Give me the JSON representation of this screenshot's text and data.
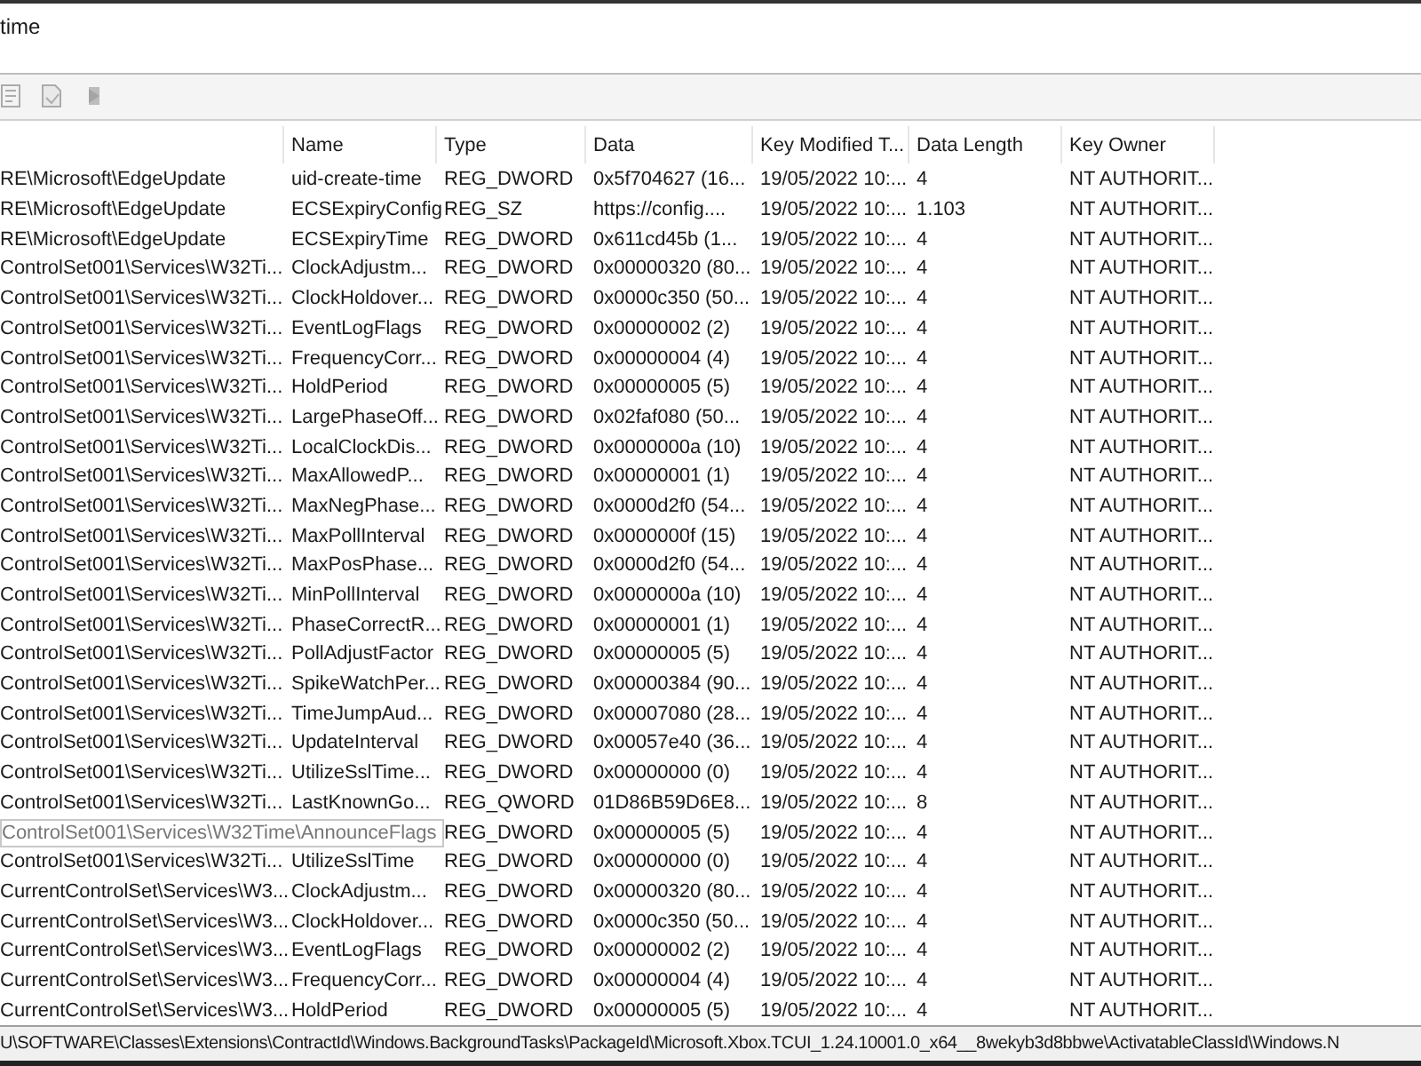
{
  "window": {
    "title": "time"
  },
  "toolbar": {
    "buttons": [
      {
        "kind": "properties",
        "disabled": true
      },
      {
        "kind": "export",
        "disabled": true
      },
      {
        "kind": "jump",
        "disabled": true
      }
    ]
  },
  "table": {
    "columns": [
      "",
      "Name",
      "Type",
      "Data",
      "Key Modified T...",
      "Data Length",
      "Key Owner"
    ],
    "rows": [
      {
        "kind": "entry",
        "cells": [
          "RE\\Microsoft\\EdgeUpdate",
          "uid-create-time",
          "REG_DWORD",
          "0x5f704627 (16...",
          "19/05/2022 10:...",
          "4",
          "NT AUTHORIT..."
        ]
      },
      {
        "kind": "entry",
        "cells": [
          "RE\\Microsoft\\EdgeUpdate",
          "ECSExpiryConfig",
          "REG_SZ",
          "https://config....",
          "19/05/2022 10:...",
          "1.103",
          "NT AUTHORIT..."
        ]
      },
      {
        "kind": "entry",
        "cells": [
          "RE\\Microsoft\\EdgeUpdate",
          "ECSExpiryTime",
          "REG_DWORD",
          "0x611cd45b (1...",
          "19/05/2022 10:...",
          "4",
          "NT AUTHORIT..."
        ]
      },
      {
        "kind": "entry",
        "cells": [
          "ControlSet001\\Services\\W32Ti...",
          "ClockAdjustm...",
          "REG_DWORD",
          "0x00000320 (80...",
          "19/05/2022 10:...",
          "4",
          "NT AUTHORIT..."
        ]
      },
      {
        "kind": "entry",
        "cells": [
          "ControlSet001\\Services\\W32Ti...",
          "ClockHoldover...",
          "REG_DWORD",
          "0x0000c350 (50...",
          "19/05/2022 10:...",
          "4",
          "NT AUTHORIT..."
        ]
      },
      {
        "kind": "entry",
        "cells": [
          "ControlSet001\\Services\\W32Ti...",
          "EventLogFlags",
          "REG_DWORD",
          "0x00000002 (2)",
          "19/05/2022 10:...",
          "4",
          "NT AUTHORIT..."
        ]
      },
      {
        "kind": "entry",
        "cells": [
          "ControlSet001\\Services\\W32Ti...",
          "FrequencyCorr...",
          "REG_DWORD",
          "0x00000004 (4)",
          "19/05/2022 10:...",
          "4",
          "NT AUTHORIT..."
        ]
      },
      {
        "kind": "entry",
        "cells": [
          "ControlSet001\\Services\\W32Ti...",
          "HoldPeriod",
          "REG_DWORD",
          "0x00000005 (5)",
          "19/05/2022 10:...",
          "4",
          "NT AUTHORIT..."
        ]
      },
      {
        "kind": "entry",
        "cells": [
          "ControlSet001\\Services\\W32Ti...",
          "LargePhaseOff...",
          "REG_DWORD",
          "0x02faf080 (50...",
          "19/05/2022 10:...",
          "4",
          "NT AUTHORIT..."
        ]
      },
      {
        "kind": "entry",
        "cells": [
          "ControlSet001\\Services\\W32Ti...",
          "LocalClockDis...",
          "REG_DWORD",
          "0x0000000a (10)",
          "19/05/2022 10:...",
          "4",
          "NT AUTHORIT..."
        ]
      },
      {
        "kind": "entry",
        "cells": [
          "ControlSet001\\Services\\W32Ti...",
          "MaxAllowedP...",
          "REG_DWORD",
          "0x00000001 (1)",
          "19/05/2022 10:...",
          "4",
          "NT AUTHORIT..."
        ]
      },
      {
        "kind": "entry",
        "cells": [
          "ControlSet001\\Services\\W32Ti...",
          "MaxNegPhase...",
          "REG_DWORD",
          "0x0000d2f0 (54...",
          "19/05/2022 10:...",
          "4",
          "NT AUTHORIT..."
        ]
      },
      {
        "kind": "entry",
        "cells": [
          "ControlSet001\\Services\\W32Ti...",
          "MaxPollInterval",
          "REG_DWORD",
          "0x0000000f (15)",
          "19/05/2022 10:...",
          "4",
          "NT AUTHORIT..."
        ]
      },
      {
        "kind": "entry",
        "cells": [
          "ControlSet001\\Services\\W32Ti...",
          "MaxPosPhase...",
          "REG_DWORD",
          "0x0000d2f0 (54...",
          "19/05/2022 10:...",
          "4",
          "NT AUTHORIT..."
        ]
      },
      {
        "kind": "entry",
        "cells": [
          "ControlSet001\\Services\\W32Ti...",
          "MinPollInterval",
          "REG_DWORD",
          "0x0000000a (10)",
          "19/05/2022 10:...",
          "4",
          "NT AUTHORIT..."
        ]
      },
      {
        "kind": "entry",
        "cells": [
          "ControlSet001\\Services\\W32Ti...",
          "PhaseCorrectR...",
          "REG_DWORD",
          "0x00000001 (1)",
          "19/05/2022 10:...",
          "4",
          "NT AUTHORIT..."
        ]
      },
      {
        "kind": "entry",
        "cells": [
          "ControlSet001\\Services\\W32Ti...",
          "PollAdjustFactor",
          "REG_DWORD",
          "0x00000005 (5)",
          "19/05/2022 10:...",
          "4",
          "NT AUTHORIT..."
        ]
      },
      {
        "kind": "entry",
        "cells": [
          "ControlSet001\\Services\\W32Ti...",
          "SpikeWatchPer...",
          "REG_DWORD",
          "0x00000384 (90...",
          "19/05/2022 10:...",
          "4",
          "NT AUTHORIT..."
        ]
      },
      {
        "kind": "entry",
        "cells": [
          "ControlSet001\\Services\\W32Ti...",
          "TimeJumpAud...",
          "REG_DWORD",
          "0x00007080 (28...",
          "19/05/2022 10:...",
          "4",
          "NT AUTHORIT..."
        ]
      },
      {
        "kind": "entry",
        "cells": [
          "ControlSet001\\Services\\W32Ti...",
          "UpdateInterval",
          "REG_DWORD",
          "0x00057e40 (36...",
          "19/05/2022 10:...",
          "4",
          "NT AUTHORIT..."
        ]
      },
      {
        "kind": "entry",
        "cells": [
          "ControlSet001\\Services\\W32Ti...",
          "UtilizeSslTime...",
          "REG_DWORD",
          "0x00000000 (0)",
          "19/05/2022 10:...",
          "4",
          "NT AUTHORIT..."
        ]
      },
      {
        "kind": "entry",
        "cells": [
          "ControlSet001\\Services\\W32Ti...",
          "LastKnownGo...",
          "REG_QWORD",
          "01D86B59D6E8...",
          "19/05/2022 10:...",
          "8",
          "NT AUTHORIT..."
        ]
      },
      {
        "kind": "tooltip",
        "tooltip": "ControlSet001\\Services\\W32Time\\AnnounceFlags",
        "cells": [
          "",
          "",
          "REG_DWORD",
          "0x00000005 (5)",
          "19/05/2022 10:...",
          "4",
          "NT AUTHORIT..."
        ]
      },
      {
        "kind": "entry",
        "cells": [
          "ControlSet001\\Services\\W32Ti...",
          "UtilizeSslTime",
          "REG_DWORD",
          "0x00000000 (0)",
          "19/05/2022 10:...",
          "4",
          "NT AUTHORIT..."
        ]
      },
      {
        "kind": "entry",
        "cells": [
          "CurrentControlSet\\Services\\W3...",
          "ClockAdjustm...",
          "REG_DWORD",
          "0x00000320 (80...",
          "19/05/2022 10:...",
          "4",
          "NT AUTHORIT..."
        ]
      },
      {
        "kind": "entry",
        "cells": [
          "CurrentControlSet\\Services\\W3...",
          "ClockHoldover...",
          "REG_DWORD",
          "0x0000c350 (50...",
          "19/05/2022 10:...",
          "4",
          "NT AUTHORIT..."
        ]
      },
      {
        "kind": "entry",
        "cells": [
          "CurrentControlSet\\Services\\W3...",
          "EventLogFlags",
          "REG_DWORD",
          "0x00000002 (2)",
          "19/05/2022 10:...",
          "4",
          "NT AUTHORIT..."
        ]
      },
      {
        "kind": "entry",
        "cells": [
          "CurrentControlSet\\Services\\W3...",
          "FrequencyCorr...",
          "REG_DWORD",
          "0x00000004 (4)",
          "19/05/2022 10:...",
          "4",
          "NT AUTHORIT..."
        ]
      },
      {
        "kind": "entry",
        "cells": [
          "CurrentControlSet\\Services\\W3...",
          "HoldPeriod",
          "REG_DWORD",
          "0x00000005 (5)",
          "19/05/2022 10:...",
          "4",
          "NT AUTHORIT..."
        ]
      }
    ]
  },
  "status_bar": "U\\SOFTWARE\\Classes\\Extensions\\ContractId\\Windows.BackgroundTasks\\PackageId\\Microsoft.Xbox.TCUI_1.24.10001.0_x64__8wekyb3d8bbwe\\ActivatableClassId\\Windows.N"
}
